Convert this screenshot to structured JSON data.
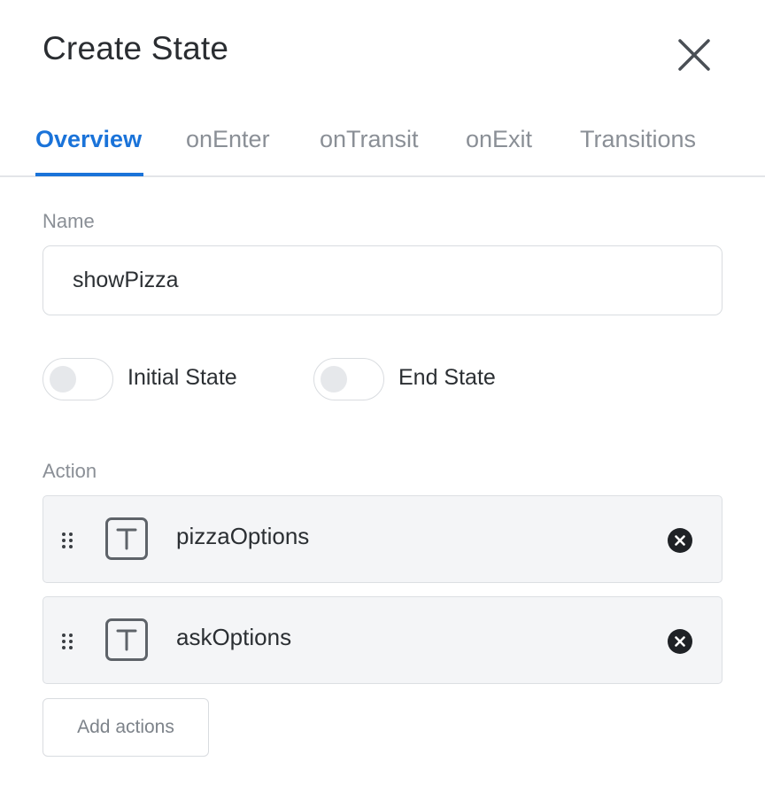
{
  "dialog": {
    "title": "Create State",
    "close_icon": "close-icon"
  },
  "tabs": [
    {
      "label": "Overview",
      "active": true
    },
    {
      "label": "onEnter",
      "active": false
    },
    {
      "label": "onTransit",
      "active": false
    },
    {
      "label": "onExit",
      "active": false
    },
    {
      "label": "Transitions",
      "active": false
    }
  ],
  "form": {
    "name_label": "Name",
    "name_value": "showPizza",
    "initial_state": {
      "label": "Initial State",
      "on": false
    },
    "end_state": {
      "label": "End State",
      "on": false
    },
    "action_label": "Action",
    "actions": [
      {
        "label": "pizzaOptions",
        "icon": "text-type-icon"
      },
      {
        "label": "askOptions",
        "icon": "text-type-icon"
      }
    ],
    "add_actions_label": "Add actions"
  },
  "colors": {
    "accent": "#1a73d9",
    "muted_text": "#8a8f96",
    "border": "#d9dce0",
    "row_bg": "#f4f5f7"
  }
}
